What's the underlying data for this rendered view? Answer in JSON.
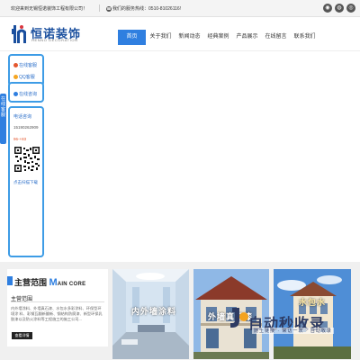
{
  "topbar": {
    "welcome": "欢迎来到无锡恒诺装饰工程有限公司！",
    "hotline_label": "我们的服务热线：",
    "hotline_number": "0510-81026116!",
    "social_icons": [
      "weibo-icon",
      "wechat-icon",
      "qq-icon"
    ]
  },
  "header": {
    "logo_cn": "恒诺装饰",
    "logo_en": "HENNO DECORATION"
  },
  "nav": {
    "items": [
      {
        "label": "首页",
        "active": true
      },
      {
        "label": "关于我们",
        "active": false
      },
      {
        "label": "新闻动态",
        "active": false
      },
      {
        "label": "经典案例",
        "active": false
      },
      {
        "label": "产品展示",
        "active": false
      },
      {
        "label": "在线留言",
        "active": false
      },
      {
        "label": "联系我们",
        "active": false
      }
    ]
  },
  "float_panel": {
    "online_consult": "在线客服",
    "qq": "QQ客服",
    "online_chat": "在线咨询",
    "hotline_title": "电话咨询",
    "phone": "15190262909",
    "tel": "96-+83",
    "tab_label": "在线客服",
    "qr_caption": "点击扫描下载"
  },
  "scope": {
    "title_prefix": "主营范围",
    "title_m": "M",
    "title_rest": "AIN CORE",
    "subtitle": "主营范围",
    "description": "内外墙涂料、外墙真石漆、水包水多彩涂料、环保型环境涂 料、彩钢瓦翻新翻新、钢结构防腐漆、新型环保乳胶漆以及防火涂料等工程施工的施工公司...",
    "button": "查看详情"
  },
  "photos": [
    {
      "caption": "内外墙涂料"
    },
    {
      "caption": "外墙真石漆"
    },
    {
      "caption": "水包水"
    }
  ],
  "watermark": {
    "name": "自动秒收录",
    "tagline": "随上链接 · 来访一次 · 自动收录"
  },
  "colors": {
    "accent": "#2f7fe0",
    "panel_border": "#3d9ce6",
    "logo_blue": "#1a4f9e",
    "logo_red": "#d9363e"
  }
}
